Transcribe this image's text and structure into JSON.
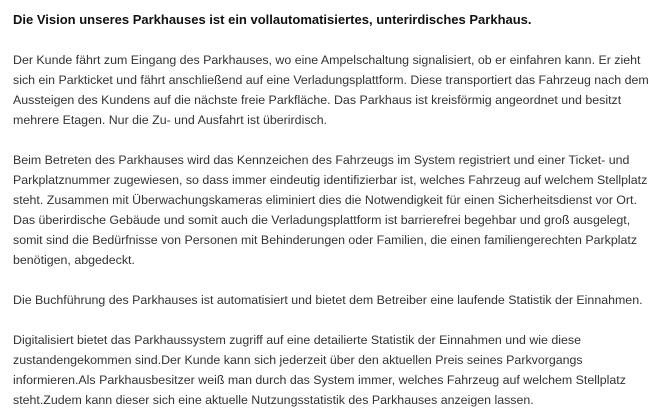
{
  "document": {
    "heading": "Die Vision unseres Parkhauses ist ein vollautomatisiertes, unterirdisches Parkhaus.",
    "paragraphs": [
      "Der Kunde fährt zum Eingang des Parkhauses, wo eine Ampelschaltung signalisiert, ob er einfahren kann. Er zieht sich ein Parkticket und fährt anschließend auf eine Verladungsplattform. Diese transportiert das Fahrzeug nach dem Aussteigen des Kundens auf die nächste freie Parkfläche. Das Parkhaus ist kreisförmig angeordnet und besitzt mehrere Etagen. Nur die Zu- und Ausfahrt ist überirdisch.",
      "Beim Betreten des Parkhauses wird das Kennzeichen des Fahrzeugs im System registriert und einer Ticket- und Parkplatznummer zugewiesen, so dass immer eindeutig identifizierbar ist, welches Fahrzeug auf welchem Stellplatz steht. Zusammen mit Überwachungskameras eliminiert dies die Notwendigkeit für einen Sicherheitsdienst vor Ort. Das überirdische Gebäude und somit auch die Verladungsplattform ist barrierefrei begehbar und groß ausgelegt, somit sind die Bedürfnisse von Personen mit Behinderungen oder Familien, die einen familiengerechten Parkplatz benötigen, abgedeckt.",
      "Die Buchführung des Parkhauses ist automatisiert und bietet dem Betreiber eine laufende Statistik der Einnahmen.",
      "Digitalisiert bietet das Parkhaussystem zugriff auf eine detailierte Statistik der Einnahmen und wie diese zustandengekommen sind.Der Kunde kann sich jederzeit über den aktuellen Preis seines Parkvorgangs informieren.Als Parkhausbesitzer weiß man durch das System immer, welches Fahrzeug auf welchem Stellplatz steht.Zudem kann dieser sich eine aktuelle Nutzungsstatistik des Parkhauses anzeigen lassen."
    ]
  }
}
